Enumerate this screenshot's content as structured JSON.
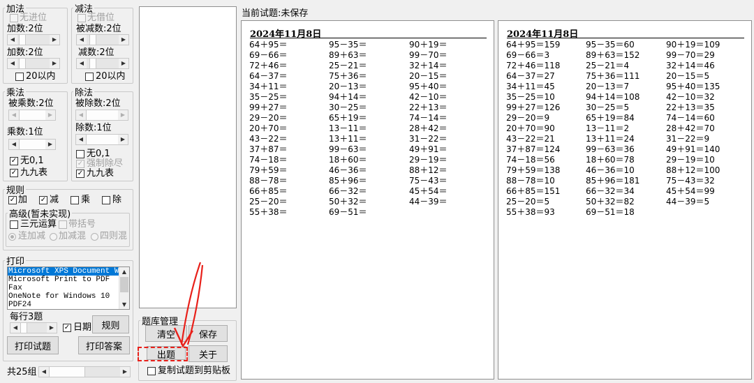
{
  "addition": {
    "title": "加法",
    "no_carry": "无进位",
    "addend1_label": "加数:2位",
    "addend2_label": "加数:2位",
    "within20": "20以内"
  },
  "subtraction": {
    "title": "减法",
    "no_borrow": "无借位",
    "minuend_label": "被减数:2位",
    "subtrahend_label": "减数:2位",
    "within20": "20以内"
  },
  "multiplication": {
    "title": "乘法",
    "multiplicand_label": "被乘数:2位",
    "multiplier_label": "乘数:1位",
    "no01": "无0,1",
    "times_table": "九九表"
  },
  "division": {
    "title": "除法",
    "dividend_label": "被除数:2位",
    "divisor_label": "除数:1位",
    "no01": "无0,1",
    "force_exact": "强制除尽",
    "times_table": "九九表"
  },
  "rules": {
    "title": "规则",
    "add": "加",
    "sub": "减",
    "mul": "乘",
    "div": "除",
    "advanced_title": "高级(暂未实现)",
    "ternary": "三元运算",
    "brackets": "带括号",
    "chain_add_sub": "连加减",
    "mixed_add_sub": "加减混",
    "four_ops": "四则混"
  },
  "print": {
    "title": "打印",
    "printers": [
      "Microsoft XPS Document Writer",
      "Microsoft Print to PDF",
      "Fax",
      "OneNote for Windows 10",
      "PDF24"
    ],
    "per_row_label": "每行3题",
    "date_label": "日期",
    "rules_button": "规则",
    "print_questions": "打印试题",
    "print_answers": "打印答案"
  },
  "groups": {
    "label": "共25组"
  },
  "library": {
    "title": "题库管理",
    "clear": "清空",
    "save": "保存",
    "generate": "出题",
    "about": "关于",
    "copy_to_clipboard": "复制试题到剪贴板"
  },
  "current": {
    "label": "当前试题:未保存"
  },
  "sheet": {
    "date": "2024年11月8日",
    "questions": [
      [
        "64＋95＝",
        "95－35＝",
        "90＋19＝"
      ],
      [
        "69－66＝",
        "89＋63＝",
        "99－70＝"
      ],
      [
        "72＋46＝",
        "25－21＝",
        "32＋14＝"
      ],
      [
        "64－37＝",
        "75＋36＝",
        "20－15＝"
      ],
      [
        "34＋11＝",
        "20－13＝",
        "95＋40＝"
      ],
      [
        "35－25＝",
        "94＋14＝",
        "42－10＝"
      ],
      [
        "99＋27＝",
        "30－25＝",
        "22＋13＝"
      ],
      [
        "29－20＝",
        "65＋19＝",
        "74－14＝"
      ],
      [
        "20＋70＝",
        "13－11＝",
        "28＋42＝"
      ],
      [
        "43－22＝",
        "13＋11＝",
        "31－22＝"
      ],
      [
        "37＋87＝",
        "99－63＝",
        "49＋91＝"
      ],
      [
        "74－18＝",
        "18＋60＝",
        "29－19＝"
      ],
      [
        "79＋59＝",
        "46－36＝",
        "88＋12＝"
      ],
      [
        "88－78＝",
        "85＋96＝",
        "75－43＝"
      ],
      [
        "66＋85＝",
        "66－32＝",
        "45＋54＝"
      ],
      [
        "25－20＝",
        "50＋32＝",
        "44－39＝"
      ],
      [
        "55＋38＝",
        "69－51＝",
        ""
      ]
    ],
    "answers": [
      [
        "64＋95＝159",
        "95－35＝60",
        "90＋19＝109"
      ],
      [
        "69－66＝3",
        "89＋63＝152",
        "99－70＝29"
      ],
      [
        "72＋46＝118",
        "25－21＝4",
        "32＋14＝46"
      ],
      [
        "64－37＝27",
        "75＋36＝111",
        "20－15＝5"
      ],
      [
        "34＋11＝45",
        "20－13＝7",
        "95＋40＝135"
      ],
      [
        "35－25＝10",
        "94＋14＝108",
        "42－10＝32"
      ],
      [
        "99＋27＝126",
        "30－25＝5",
        "22＋13＝35"
      ],
      [
        "29－20＝9",
        "65＋19＝84",
        "74－14＝60"
      ],
      [
        "20＋70＝90",
        "13－11＝2",
        "28＋42＝70"
      ],
      [
        "43－22＝21",
        "13＋11＝24",
        "31－22＝9"
      ],
      [
        "37＋87＝124",
        "99－63＝36",
        "49＋91＝140"
      ],
      [
        "74－18＝56",
        "18＋60＝78",
        "29－19＝10"
      ],
      [
        "79＋59＝138",
        "46－36＝10",
        "88＋12＝100"
      ],
      [
        "88－78＝10",
        "85＋96＝181",
        "75－43＝32"
      ],
      [
        "66＋85＝151",
        "66－32＝34",
        "45＋54＝99"
      ],
      [
        "25－20＝5",
        "50＋32＝82",
        "44－39＝5"
      ],
      [
        "55＋38＝93",
        "69－51＝18",
        ""
      ]
    ]
  },
  "colors": {
    "selection": "#0078d7",
    "annotation": "#e8201a"
  }
}
